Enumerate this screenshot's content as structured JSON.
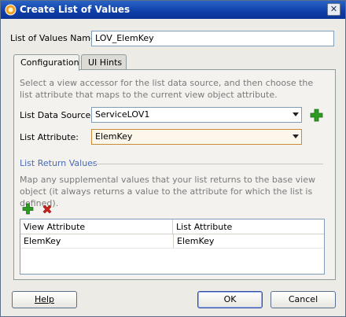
{
  "window": {
    "title": "Create List of Values",
    "close_glyph": "✕"
  },
  "lov_name": {
    "label": "List of Values Name:",
    "value": "LOV_ElemKey"
  },
  "tabs": [
    {
      "label": "Configuration",
      "active": true
    },
    {
      "label": "UI Hints",
      "active": false
    }
  ],
  "config": {
    "description": "Select a view accessor for the list data source, and then choose the list attribute that maps to the current view object attribute.",
    "data_source": {
      "label": "List Data Source:",
      "value": "ServiceLOV1"
    },
    "list_attribute": {
      "label": "List Attribute:",
      "value": "ElemKey"
    },
    "return_values": {
      "heading": "List Return Values",
      "description": "Map any supplemental values that your list returns to the base view object (it always returns a value to the attribute for which the list is defined).",
      "columns": [
        "View Attribute",
        "List Attribute"
      ],
      "rows": [
        [
          "ElemKey",
          "ElemKey"
        ]
      ]
    }
  },
  "buttons": {
    "help": "Help",
    "ok": "OK",
    "cancel": "Cancel"
  },
  "colors": {
    "titlebar": "#0e3ea8",
    "add_icon": "#2e9b22",
    "remove_icon": "#d0201a",
    "highlight_field": "#fdf6ea"
  },
  "icons": {
    "app": "jdeveloper-icon",
    "add": "plus-icon",
    "remove": "x-icon"
  }
}
